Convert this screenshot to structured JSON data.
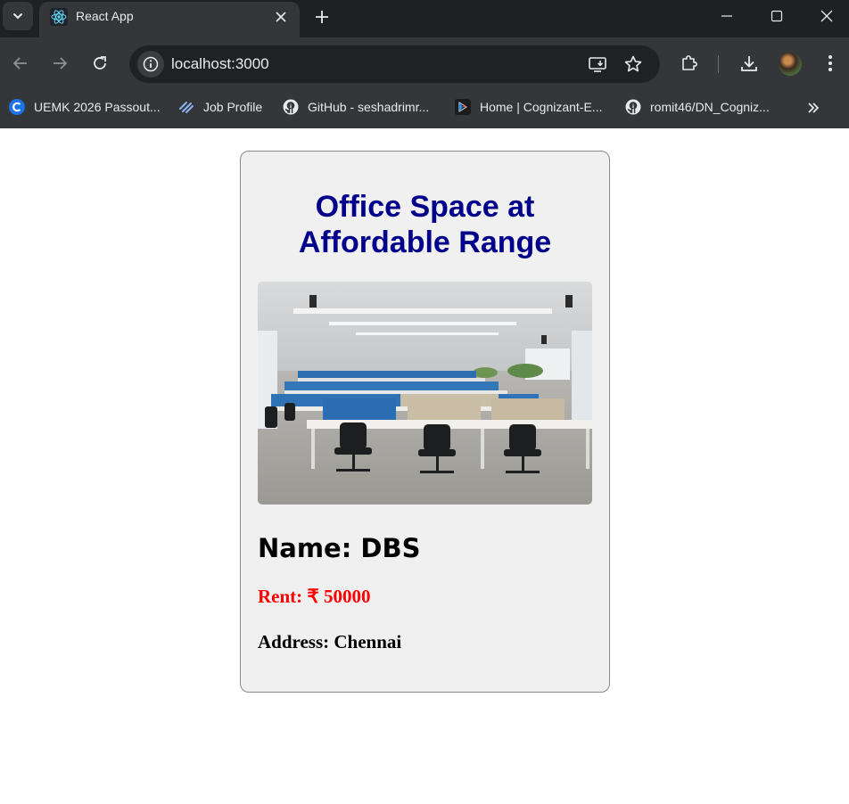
{
  "browser": {
    "tab_title": "React App",
    "url": "localhost:3000",
    "bookmarks": [
      {
        "label": "UEMK 2026 Passout...",
        "icon": "c-logo-icon"
      },
      {
        "label": "Job Profile",
        "icon": "job-profile-icon"
      },
      {
        "label": "GitHub - seshadrimr...",
        "icon": "github-icon"
      },
      {
        "label": "Home | Cognizant-E...",
        "icon": "cognizant-icon"
      },
      {
        "label": "romit46/DN_Cogniz...",
        "icon": "github-icon"
      }
    ]
  },
  "page": {
    "title": "Office Space at Affordable Range",
    "image_alt": "Office space",
    "name": "Name: DBS",
    "rent": "Rent: ₹ 50000",
    "address": "Address: Chennai",
    "colors": {
      "title": "#00008b",
      "rent": "#ff0000",
      "card_background": "#f0f0f0"
    }
  }
}
